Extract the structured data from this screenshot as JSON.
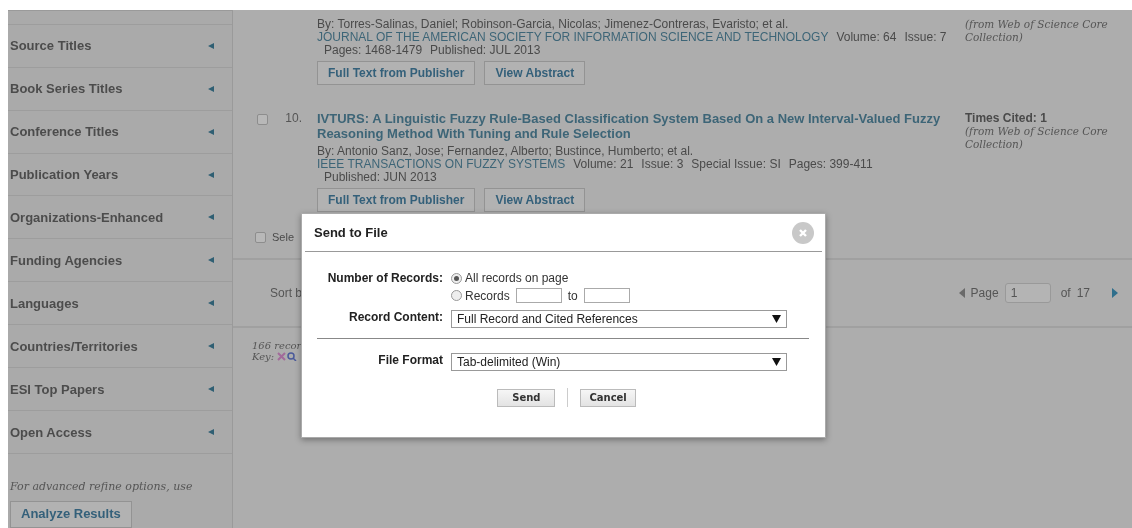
{
  "sidebar": {
    "items": [
      {
        "label": "Source Titles",
        "expanded": false
      },
      {
        "label": "Book Series Titles",
        "expanded": false
      },
      {
        "label": "Conference Titles",
        "expanded": false
      },
      {
        "label": "Publication Years",
        "expanded": false
      },
      {
        "label": "Organizations-Enhanced",
        "expanded": false
      },
      {
        "label": "Funding Agencies",
        "expanded": false
      },
      {
        "label": "Languages",
        "expanded": false
      },
      {
        "label": "Countries/Territories",
        "expanded": false
      },
      {
        "label": "ESI Top Papers",
        "expanded": false
      },
      {
        "label": "Open Access",
        "expanded": false
      }
    ],
    "advanced_note": "For advanced refine options, use",
    "analyze_button": "Analyze Results"
  },
  "records": [
    {
      "authors": "By: Torres-Salinas, Daniel; Robinson-Garcia, Nicolas; Jimenez-Contreras, Evaristo; et al.",
      "source": "JOURNAL OF THE AMERICAN SOCIETY FOR INFORMATION SCIENCE AND TECHNOLOGY",
      "fields": [
        "Volume: 64",
        "Issue: 7"
      ],
      "extra_fields": [
        "Pages: 1468-1479",
        "Published: JUL 2013"
      ],
      "buttons": [
        "Full Text from Publisher",
        "View Abstract"
      ],
      "times_cited_note": "(from Web of Science Core Collection)"
    },
    {
      "number": "10.",
      "checked": false,
      "title": "IVTURS: A Linguistic Fuzzy Rule-Based Classification System Based On a New Interval-Valued Fuzzy Reasoning Method With Tuning and Rule Selection",
      "authors": "By: Antonio Sanz, Jose; Fernandez, Alberto; Bustince, Humberto; et al.",
      "source": "IEEE TRANSACTIONS ON FUZZY SYSTEMS",
      "fields": [
        "Volume: 21",
        "Issue: 3",
        "Special Issue: SI",
        "Pages: 399-411"
      ],
      "extra_fields": [
        "Published: JUN 2013"
      ],
      "buttons": [
        "Full Text from Publisher",
        "View Abstract"
      ],
      "times_cited": "Times Cited: 1",
      "times_cited_note": "(from Web of Science Core Collection)"
    }
  ],
  "select_row": {
    "label": "Sele",
    "checked": false
  },
  "sort_bar": {
    "label": "Sort b",
    "page_label": "Page",
    "page": "1",
    "of": "of",
    "total": "17"
  },
  "footer": {
    "count": "166 recor",
    "key": "Key:"
  },
  "dialog": {
    "title": "Send to File",
    "number_label": "Number of Records:",
    "options": [
      {
        "label": "All records on page",
        "selected": true,
        "kind": "plain"
      },
      {
        "label": "Records",
        "selected": false,
        "kind": "range",
        "to": "to"
      }
    ],
    "content_label": "Record Content:",
    "content_value": "Full Record and Cited References",
    "format_label": "File Format",
    "format_value": "Tab-delimited (Win)",
    "send": "Send",
    "cancel": "Cancel"
  }
}
